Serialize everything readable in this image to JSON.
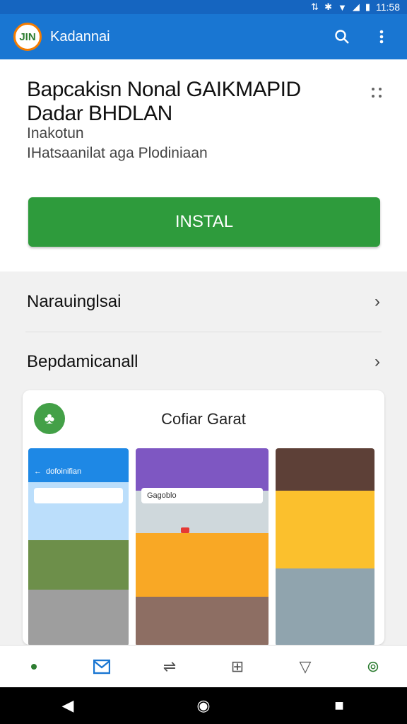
{
  "status_bar": {
    "time": "11:58"
  },
  "app_bar": {
    "logo_text": "JIN",
    "title": "Kadannai"
  },
  "header": {
    "title": "Bapcakisn Nonal GAIKMAPID Dadar BHDLAN",
    "subtitle": "Inakotun",
    "subtitle2": "IHatsaanilat aga Plodiniaan",
    "install_label": "INSTAL"
  },
  "sections": [
    {
      "label": "Narauinglsai"
    },
    {
      "label": "Bepdamicanall"
    }
  ],
  "gallery": {
    "title": "Cofiar Garat",
    "shots": [
      {
        "bar_text": "dofoinifian",
        "search_text": ""
      },
      {
        "bar_text": "",
        "search_text": "Gagoblo",
        "sign_text": ""
      },
      {}
    ]
  },
  "colors": {
    "app_bar": "#1976d2",
    "install": "#2e9b3c",
    "accent_green": "#2e7d32"
  }
}
